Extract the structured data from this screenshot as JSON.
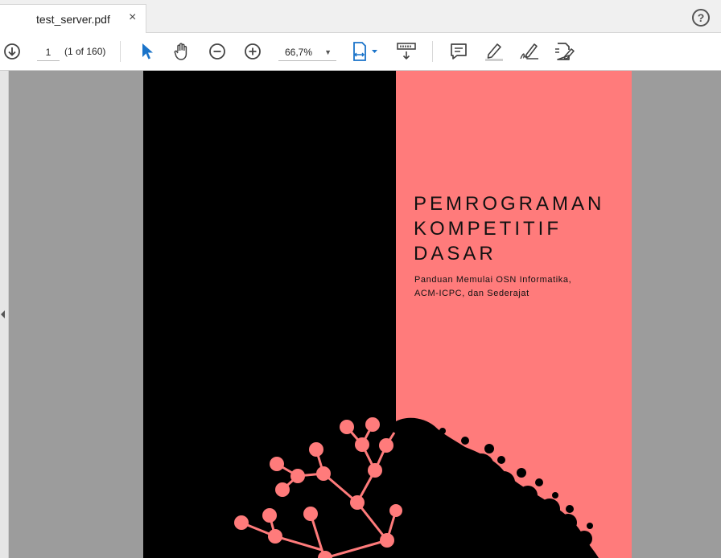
{
  "tab": {
    "title": "test_server.pdf",
    "close": "×"
  },
  "help": {
    "label": "?"
  },
  "toolbar": {
    "page_current": "1",
    "page_count": "(1 of 160)",
    "zoom_value": "66,7%"
  },
  "icons": {
    "scroll_down": "scroll-down-icon",
    "select": "select-cursor-icon",
    "hand": "hand-tool-icon",
    "zoom_out": "zoom-out-icon",
    "zoom_in": "zoom-in-icon",
    "fit_page": "fit-page-icon",
    "rotate": "page-display-icon",
    "comment": "comment-icon",
    "highlight": "highlight-icon",
    "sign": "sign-icon",
    "fill_sign": "fill-sign-icon"
  },
  "document": {
    "title": "PEMROGRAMAN\nKOMPETITIF\nDASAR",
    "subtitle": "Panduan Memulai OSN Informatika,\nACM-ICPC, dan Sederajat"
  },
  "colors": {
    "cover_pink": "#ff7b7b",
    "cover_black": "#000000",
    "select_blue": "#1a73c9"
  }
}
